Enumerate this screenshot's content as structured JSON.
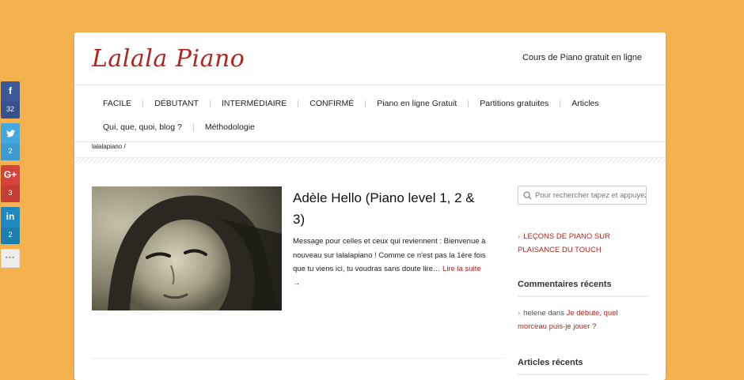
{
  "share": [
    {
      "network": "facebook",
      "icon": "f",
      "count": "32"
    },
    {
      "network": "twitter",
      "icon": "t",
      "count": "2"
    },
    {
      "network": "googleplus",
      "icon": "G+",
      "count": "3"
    },
    {
      "network": "linkedin",
      "icon": "in",
      "count": "2"
    }
  ],
  "share_more": "•••",
  "header": {
    "logo": "Lalala Piano",
    "tagline": "Cours de Piano gratuit en ligne"
  },
  "nav": {
    "row1": [
      "FACILE",
      "DÉBUTANT",
      "INTERMÉDIAIRE",
      "CONFIRMÉ",
      "Piano en ligne Gratuit",
      "Partitions gratuites",
      "Articles"
    ],
    "row2": [
      "Qui, que, quoi, blog ?",
      "Méthodologie"
    ]
  },
  "breadcrumb": "lalalapiano /",
  "post": {
    "title": "Adèle Hello (Piano level 1, 2 & 3)",
    "excerpt": "Message pour celles et ceux qui reviennent : Bienvenue à nouveau sur lalalapiano ! Comme ce n'est pas la 1ère fois que tu viens ici, tu voudras sans doute lire…",
    "read_more": "Lire la suite →"
  },
  "sidebar": {
    "search_placeholder": "Pour rechercher tapez et appuyez",
    "featured_link": "LEÇONS DE PIANO SUR PLAISANCE DU TOUCH",
    "recent_comments_title": "Commentaires récents",
    "comment": {
      "author": "helene",
      "connector": "dans",
      "post_link": "Je débute, quel morceau puis-je jouer ?"
    },
    "recent_articles_title": "Articles récents"
  },
  "colors": {
    "background": "#f4b24e",
    "accent": "#b0251f",
    "facebook": "#3b5998",
    "twitter": "#44a8e0",
    "googleplus": "#d5443a",
    "linkedin": "#1f88be"
  }
}
